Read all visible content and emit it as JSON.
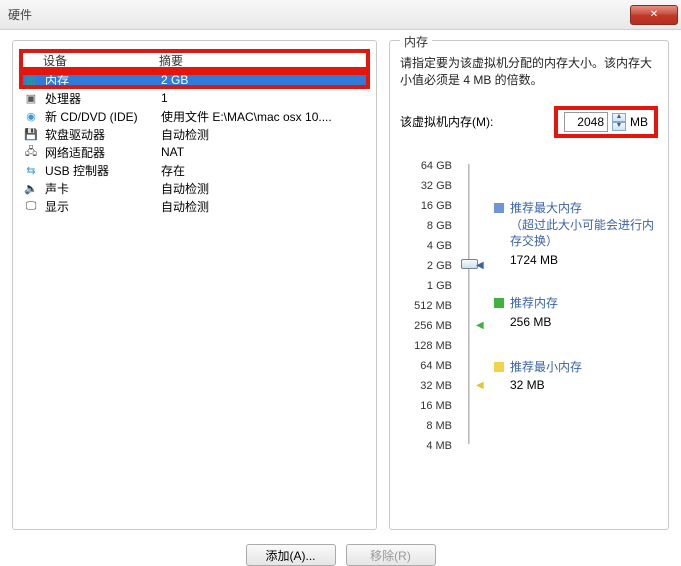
{
  "titlebar": {
    "title": "硬件"
  },
  "left": {
    "header": {
      "device": "设备",
      "summary": "摘要"
    },
    "rows": [
      {
        "icon": "▥",
        "iconClass": "ic-mem",
        "iconName": "memory-icon",
        "name": "内存",
        "summary": "2 GB",
        "selected": true
      },
      {
        "icon": "▣",
        "iconClass": "ic-cpu",
        "iconName": "processor-icon",
        "name": "处理器",
        "summary": "1"
      },
      {
        "icon": "◉",
        "iconClass": "ic-cd",
        "iconName": "cd-dvd-icon",
        "name": "新 CD/DVD (IDE)",
        "summary": "使用文件 E:\\MAC\\mac osx 10...."
      },
      {
        "icon": "💾",
        "iconClass": "ic-fd",
        "iconName": "floppy-icon",
        "name": "软盘驱动器",
        "summary": "自动检测"
      },
      {
        "icon": "🖧",
        "iconClass": "ic-net",
        "iconName": "network-adapter-icon",
        "name": "网络适配器",
        "summary": "NAT"
      },
      {
        "icon": "⇆",
        "iconClass": "ic-usb",
        "iconName": "usb-controller-icon",
        "name": "USB 控制器",
        "summary": "存在"
      },
      {
        "icon": "🔈",
        "iconClass": "ic-snd",
        "iconName": "sound-card-icon",
        "name": "声卡",
        "summary": "自动检测"
      },
      {
        "icon": "🖵",
        "iconClass": "ic-dsp",
        "iconName": "display-icon",
        "name": "显示",
        "summary": "自动检测"
      }
    ],
    "buttons": {
      "add": "添加(A)...",
      "remove": "移除(R)"
    }
  },
  "right": {
    "group": "内存",
    "desc": "请指定要为该虚拟机分配的内存大小。该内存大小值必须是 4 MB 的倍数。",
    "memLabel": "该虚拟机内存(M):",
    "memValue": "2048",
    "memUnit": "MB",
    "ticks": [
      "64 GB",
      "32 GB",
      "16 GB",
      "8 GB",
      "4 GB",
      "2 GB",
      "1 GB",
      "512 MB",
      "256 MB",
      "128 MB",
      "64 MB",
      "32 MB",
      "16 MB",
      "8 MB",
      "4 MB"
    ],
    "legend": {
      "max": {
        "label": "推荐最大内存",
        "note": "（超过此大小可能会进行内存交换）",
        "value": "1724 MB",
        "color": "#6f95d8"
      },
      "rec": {
        "label": "推荐内存",
        "value": "256 MB",
        "color": "#3fb23f"
      },
      "min": {
        "label": "推荐最小内存",
        "value": "32 MB",
        "color": "#f2d44a"
      }
    }
  }
}
